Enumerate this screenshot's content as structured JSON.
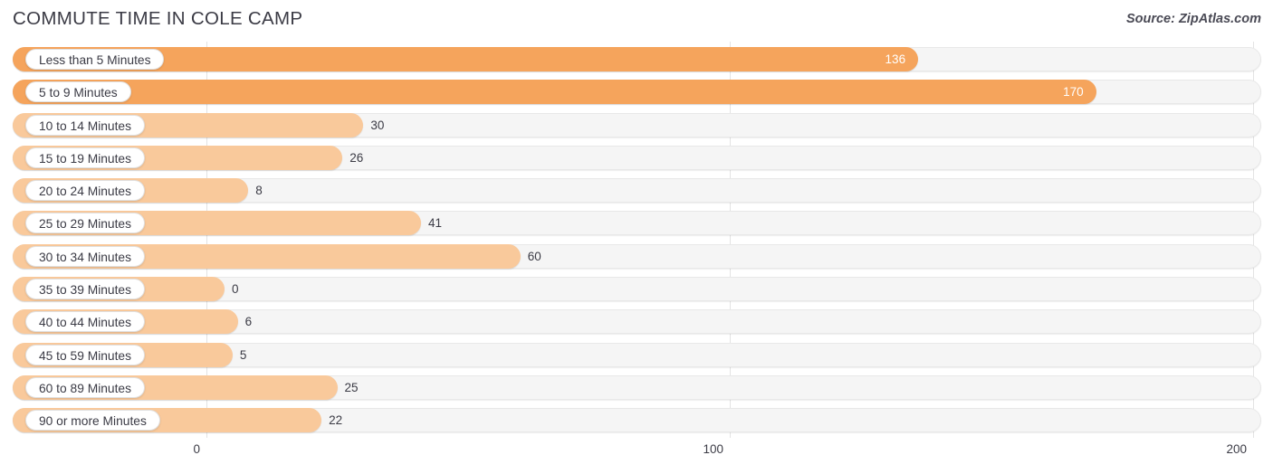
{
  "header": {
    "title": "COMMUTE TIME IN COLE CAMP",
    "source": "Source: ZipAtlas.com"
  },
  "colors": {
    "bar_high": "#F5A45C",
    "bar_low": "#F9C99B",
    "track": "#F5F5F5",
    "gridline": "#E3E3E3",
    "text": "#3B3B45",
    "value_inside": "#FFFFFF"
  },
  "chart_data": {
    "type": "bar",
    "orientation": "horizontal",
    "title": "COMMUTE TIME IN COLE CAMP",
    "xlabel": "",
    "ylabel": "",
    "xlim": [
      0,
      200
    ],
    "xticks": [
      0,
      100,
      200
    ],
    "xtick_labels": [
      "0",
      "100",
      "200"
    ],
    "grid": true,
    "legend": false,
    "categories": [
      "Less than 5 Minutes",
      "5 to 9 Minutes",
      "10 to 14 Minutes",
      "15 to 19 Minutes",
      "20 to 24 Minutes",
      "25 to 29 Minutes",
      "30 to 34 Minutes",
      "35 to 39 Minutes",
      "40 to 44 Minutes",
      "45 to 59 Minutes",
      "60 to 89 Minutes",
      "90 or more Minutes"
    ],
    "values": [
      136,
      170,
      30,
      26,
      8,
      41,
      60,
      0,
      6,
      5,
      25,
      22
    ],
    "value_labels": [
      "136",
      "170",
      "30",
      "26",
      "8",
      "41",
      "60",
      "0",
      "6",
      "5",
      "25",
      "22"
    ]
  }
}
